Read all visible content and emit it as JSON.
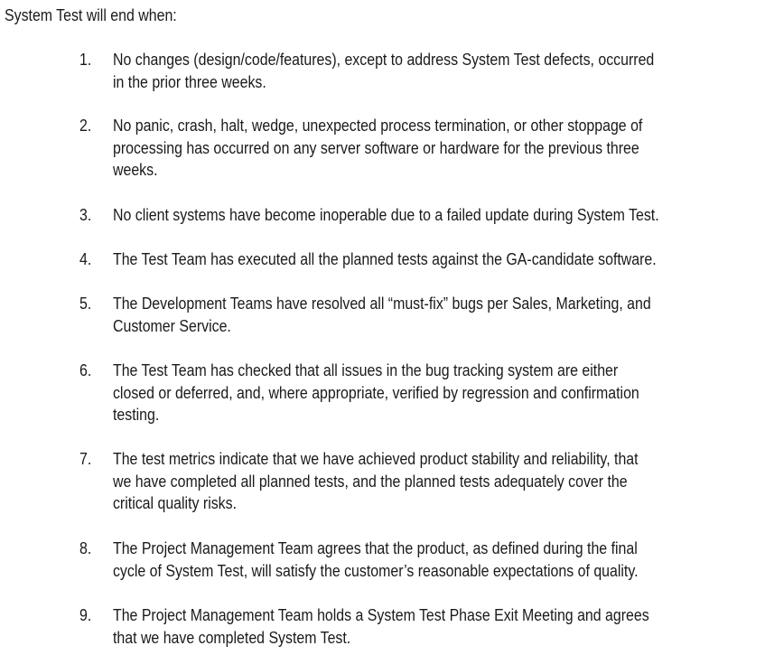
{
  "document": {
    "intro": "System Test will end when:",
    "criteria": [
      {
        "number": "1.",
        "text": "No changes (design/code/features), except to address System Test defects, occurred\nin the prior three weeks."
      },
      {
        "number": "2.",
        "text": "No panic, crash, halt, wedge, unexpected process termination, or other stoppage of\nprocessing has occurred on any server software or hardware for the previous three\nweeks."
      },
      {
        "number": "3.",
        "text": "No client systems have become inoperable due to a failed update during System Test."
      },
      {
        "number": "4.",
        "text": "The Test Team has executed all the planned tests against the GA-candidate software."
      },
      {
        "number": "5.",
        "text": "The Development Teams have resolved all “must-fix” bugs per Sales, Marketing, and\nCustomer Service."
      },
      {
        "number": "6.",
        "text": "The Test Team has checked that all issues in the bug tracking system are either\nclosed or deferred, and, where appropriate, verified by regression and confirmation\ntesting."
      },
      {
        "number": "7.",
        "text": "The test metrics indicate that we have achieved product stability and reliability, that\nwe have completed all planned tests, and the planned tests adequately cover the\ncritical quality risks."
      },
      {
        "number": "8.",
        "text": "The Project Management Team agrees that the product, as defined during the final\ncycle of System Test, will satisfy the customer’s reasonable expectations of quality."
      },
      {
        "number": "9.",
        "text": "The Project Management Team holds a System Test Phase Exit Meeting and agrees\nthat we have completed System Test."
      }
    ]
  }
}
